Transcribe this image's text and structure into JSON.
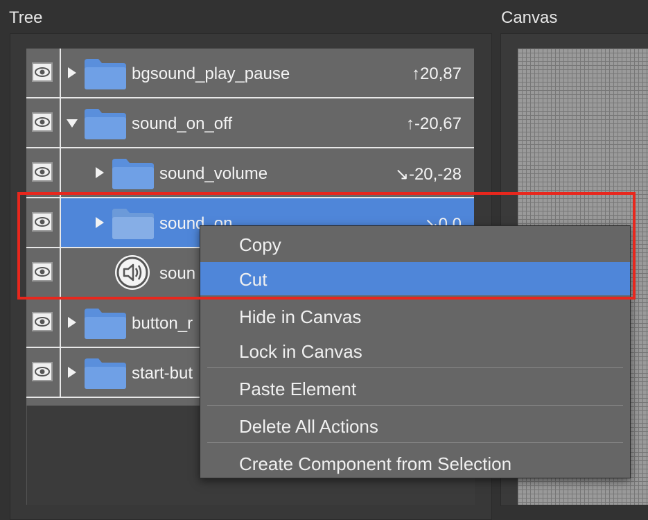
{
  "tree": {
    "title": "Tree",
    "rows": [
      {
        "name": "bgsound_play_pause",
        "coords": "↑20,87",
        "expanded": false
      },
      {
        "name": "sound_on_off",
        "coords": "↑-20,67",
        "expanded": true
      },
      {
        "name": "sound_volume",
        "coords": "↘-20,-28",
        "expanded": false
      },
      {
        "name": "sound_on",
        "coords": "↘0,0",
        "expanded": false,
        "selected": true
      },
      {
        "name": "soun"
      },
      {
        "name": "button_r",
        "expanded": false
      },
      {
        "name": "start-but",
        "expanded": false
      }
    ]
  },
  "canvas": {
    "title": "Canvas"
  },
  "context_menu": {
    "items": [
      "Copy",
      "Cut",
      "Hide in Canvas",
      "Lock in Canvas",
      "Paste Element",
      "Delete All Actions",
      "Create Component from Selection"
    ],
    "highlighted": "Cut"
  },
  "colors": {
    "selection": "#4f86d9",
    "folder": "#5a8fdc",
    "highlight_box": "#e8271d"
  }
}
